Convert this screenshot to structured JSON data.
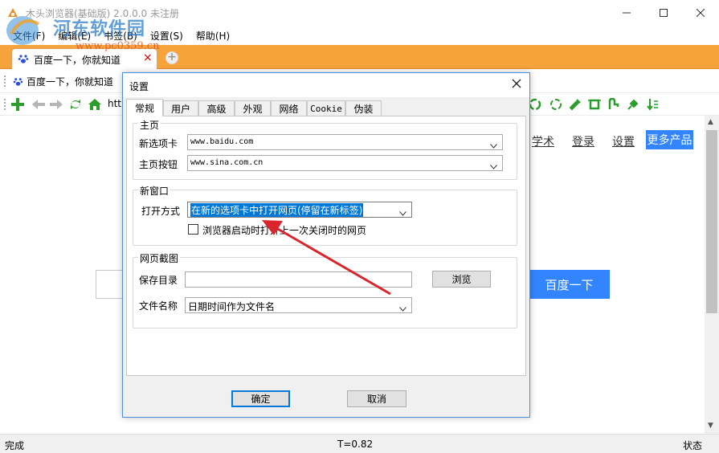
{
  "window": {
    "title": "木头浏览器(基础版) 2.0.0.0 未注册"
  },
  "watermark": {
    "name": "河东软件园",
    "url": "www.pc0359.cn"
  },
  "menu": [
    "文件(F)",
    "编辑(E)",
    "书签(B)",
    "设置(S)",
    "帮助(H)"
  ],
  "tabs": [
    {
      "title": "百度一下，你就知道",
      "close": "×"
    }
  ],
  "new_tab": "+",
  "favorites": [
    {
      "label": "百度一下，你就知道"
    }
  ],
  "address": {
    "partial": "htt"
  },
  "page": {
    "links": [
      "学术",
      "登录",
      "设置"
    ],
    "more_button": "更多产品",
    "search_button": "百度一下"
  },
  "status": {
    "left": "完成",
    "timing": "T=0.82",
    "right": "状态"
  },
  "dialog": {
    "title": "设置",
    "tabs": [
      "常规",
      "用户",
      "高级",
      "外观",
      "网络",
      "Cookie",
      "伪装"
    ],
    "active_tab": "常规",
    "homepage_group": {
      "label": "主页",
      "new_tab_label": "新选项卡",
      "new_tab_value": "www.baidu.com",
      "home_button_label": "主页按钮",
      "home_button_value": "www.sina.com.cn"
    },
    "new_window_group": {
      "label": "新窗口",
      "open_mode_label": "打开方式",
      "open_mode_value": "在新的选项卡中打开网页(停留在新标签)",
      "restore_label": "浏览器启动时打开上一次关闭时的网页",
      "restore_checked": false
    },
    "screenshot_group": {
      "label": "网页截图",
      "save_dir_label": "保存目录",
      "save_dir_value": "",
      "browse_button": "浏览",
      "file_name_label": "文件名称",
      "file_name_value": "日期时间作为文件名"
    },
    "ok_button": "确定",
    "cancel_button": "取消"
  },
  "colors": {
    "tabstrip": "#f7a33c",
    "accent_blue": "#3385ff",
    "annotation_arrow": "#d9262c",
    "focus_blue": "#0078d7"
  }
}
